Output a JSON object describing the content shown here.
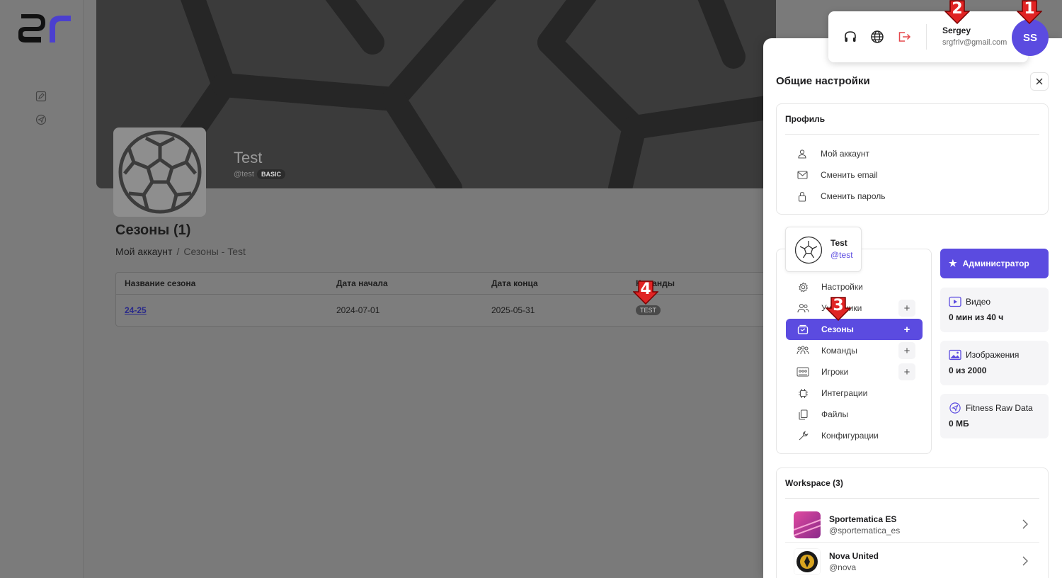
{
  "app": {
    "logo_text": "sr"
  },
  "team": {
    "name": "Test",
    "handle": "@test",
    "plan_badge": "BASIC"
  },
  "seasons": {
    "title": "Сезоны (1)",
    "breadcrumb": {
      "root": "Мой аккаунт",
      "separator": "/",
      "current": "Сезоны - Test"
    },
    "table": {
      "headers": [
        "Название сезона",
        "Дата начала",
        "Дата конца",
        "Команды"
      ],
      "rows": [
        {
          "name": "24-25",
          "start": "2024-07-01",
          "end": "2025-05-31",
          "team_badge": "TEST"
        }
      ]
    }
  },
  "user": {
    "name": "Sergey",
    "email": "srgfrlv@gmail.com",
    "initials": "SS"
  },
  "panel": {
    "title": "Общие настройки",
    "profile": {
      "title": "Профиль",
      "items": [
        "Мой аккаунт",
        "Сменить email",
        "Сменить пароль"
      ]
    },
    "org": {
      "name": "Test",
      "handle": "@test",
      "nav": [
        "Настройки",
        "Участники",
        "Сезоны",
        "Команды",
        "Игроки",
        "Интеграции",
        "Файлы",
        "Конфигурации"
      ],
      "active": "Сезоны",
      "plus": "+"
    },
    "role_button": "Администратор",
    "stats": [
      {
        "label": "Видео",
        "value": "0 мин из 40 ч"
      },
      {
        "label": "Изображения",
        "value": "0 из 2000"
      },
      {
        "label": "Fitness Raw Data",
        "value": "0 МБ"
      }
    ],
    "workspace": {
      "title": "Workspace (3)",
      "items": [
        {
          "name": "Sportematica ES",
          "handle": "@sportematica_es"
        },
        {
          "name": "Nova United",
          "handle": "@nova"
        }
      ]
    }
  },
  "markers": [
    "1",
    "2",
    "3",
    "4"
  ],
  "colors": {
    "accent": "#5b4be0",
    "marker_red": "#e02424",
    "overlay": "#7a7a7a"
  }
}
